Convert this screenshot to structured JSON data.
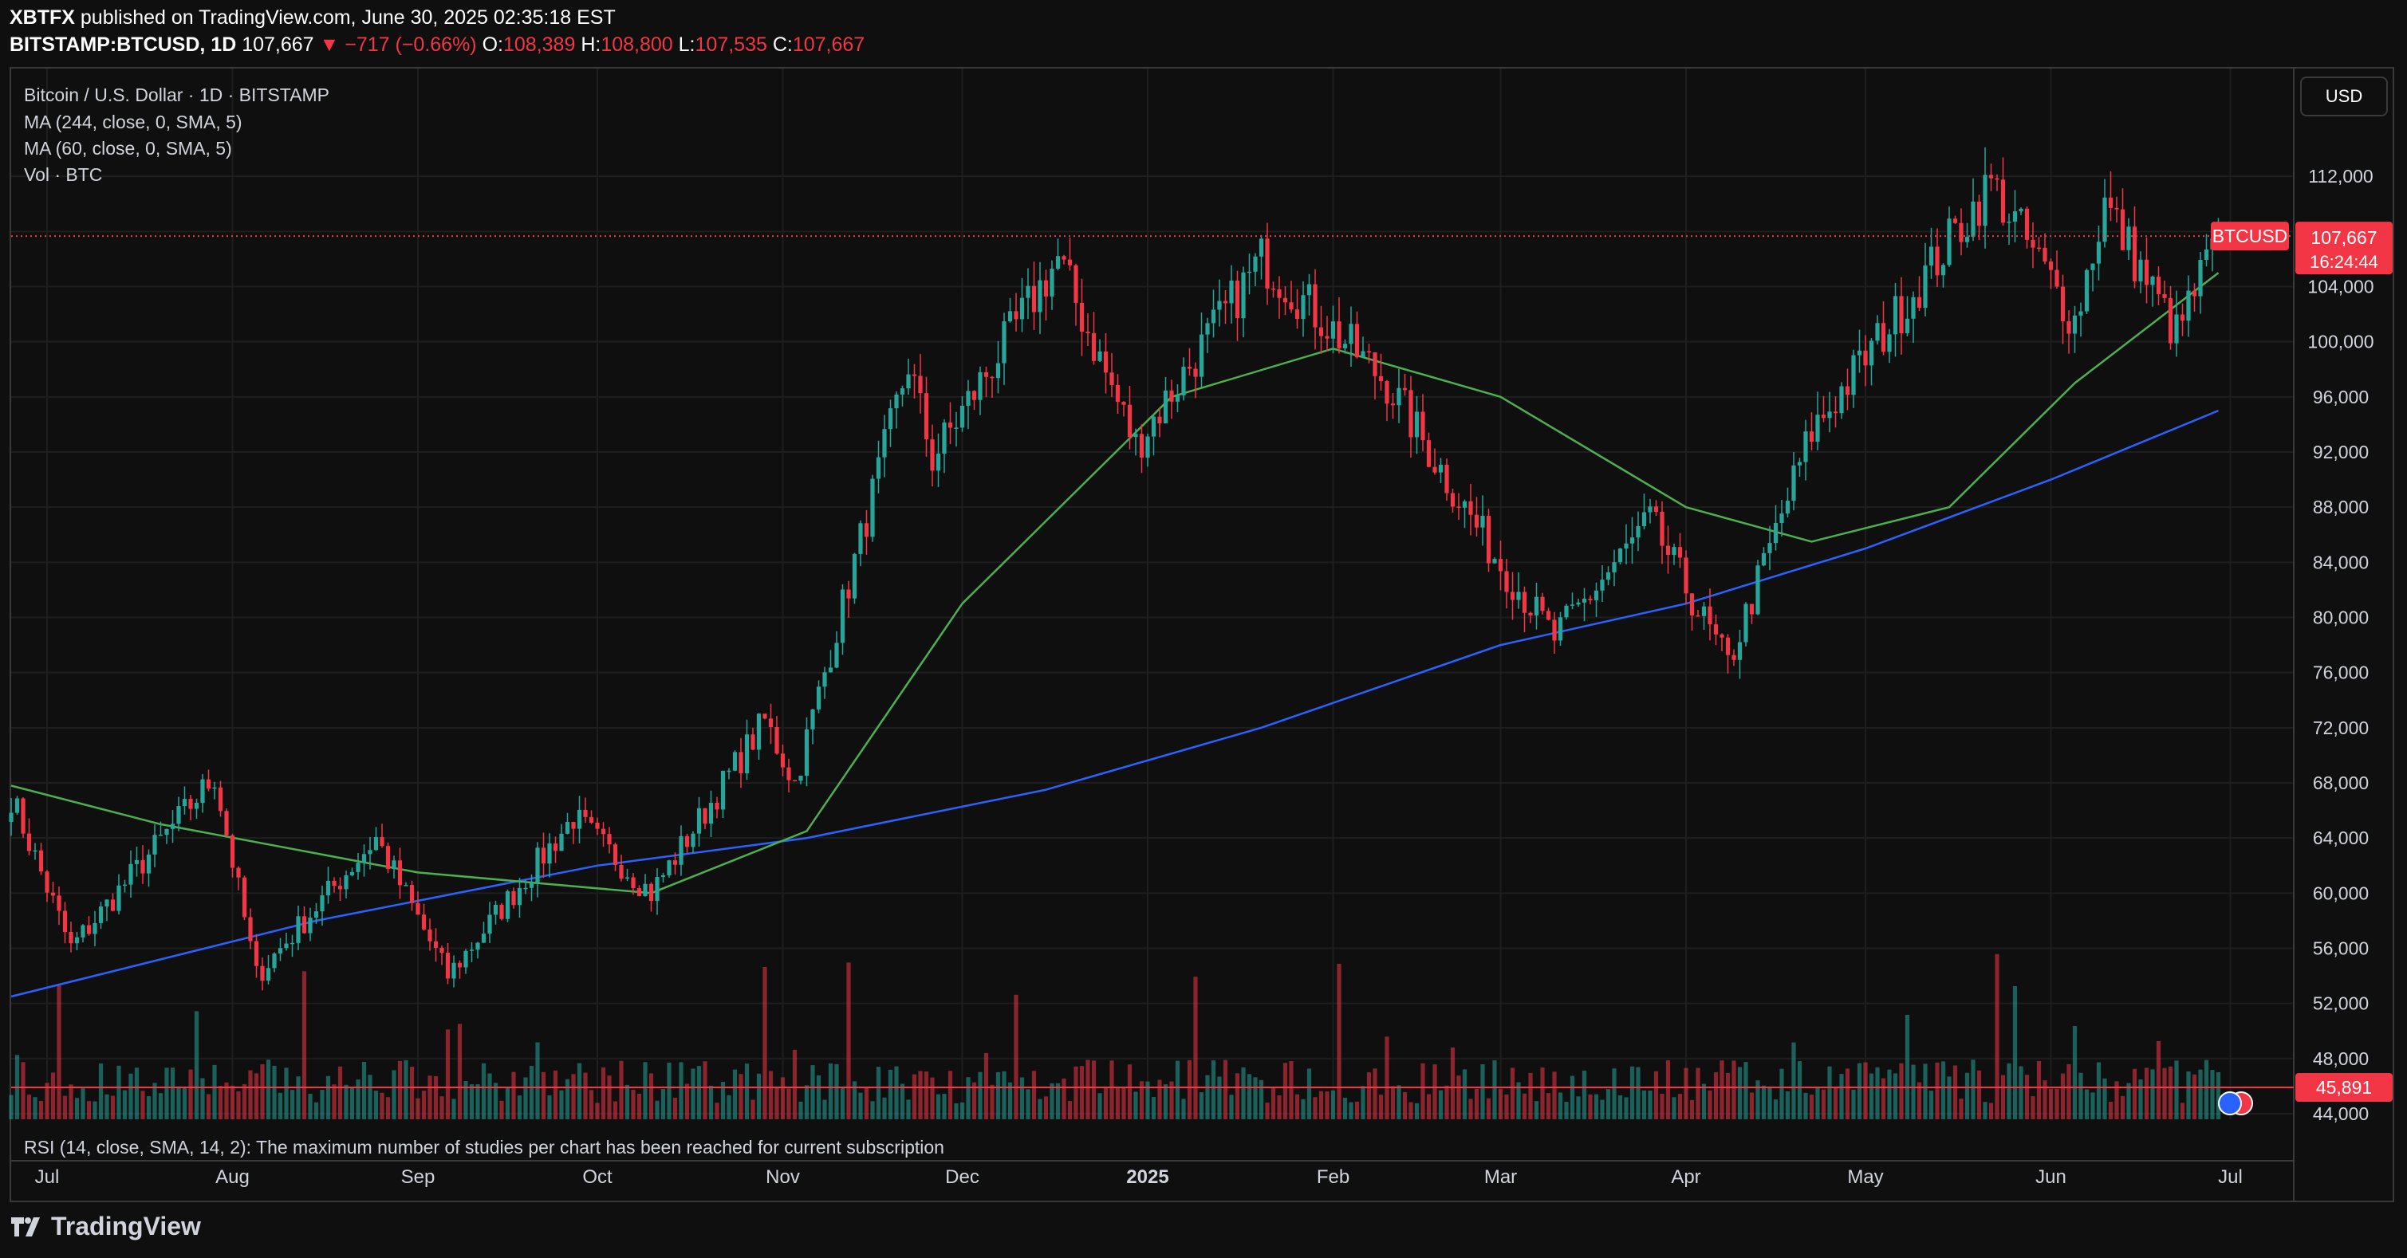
{
  "header": {
    "publisher": "XBTFX",
    "published_text": "published on TradingView.com, June 30, 2025 02:35:18 EST",
    "symbol_line": "BITSTAMP:BTCUSD, 1D",
    "last_price": "107,667",
    "change": "▼ −717 (−0.66%)",
    "open_label": "O:",
    "open": "108,389",
    "high_label": "H:",
    "high": "108,800",
    "low_label": "L:",
    "low": "107,535",
    "close_label": "C:",
    "close": "107,667"
  },
  "legend": {
    "title": "Bitcoin / U.S. Dollar · 1D · BITSTAMP",
    "ma1": "MA (244, close, 0, SMA, 5)",
    "ma2": "MA (60, close, 0, SMA, 5)",
    "vol": "Vol · BTC",
    "rsi_note": "RSI (14, close, SMA, 14, 2): The maximum number of studies per chart has been reached for current subscription"
  },
  "currency_button": "USD",
  "price_badges": {
    "symbol": "BTCUSD",
    "price": "107,667",
    "countdown": "16:24:44",
    "volume_value": "45,891"
  },
  "colors": {
    "up": "#26a69a",
    "down": "#f23645",
    "ma244": "#2962ff",
    "ma60": "#4caf50",
    "background": "#0f0f0f",
    "grid": "#1e1e1e"
  },
  "footer": {
    "brand": "TradingView"
  },
  "chart_data": {
    "type": "candlestick",
    "timeframe": "1D",
    "x_ticks": [
      "Jul",
      "Aug",
      "Sep",
      "Oct",
      "Nov",
      "Dec",
      "2025",
      "Feb",
      "Mar",
      "Apr",
      "May",
      "Jun",
      "Jul"
    ],
    "y_ticks": [
      "112,000",
      "108,000",
      "104,000",
      "100,000",
      "96,000",
      "92,000",
      "88,000",
      "84,000",
      "80,000",
      "76,000",
      "72,000",
      "68,000",
      "64,000",
      "60,000",
      "56,000",
      "52,000",
      "48,000",
      "44,000"
    ],
    "ylim": [
      44000,
      116000
    ],
    "current_price": 107667,
    "series": [
      {
        "name": "MA (244, close, 0, SMA, 5)"
      },
      {
        "name": "MA (60, close, 0, SMA, 5)"
      },
      {
        "name": "Vol · BTC"
      }
    ],
    "key_closes": [
      {
        "date": "2024-06-25",
        "close": 67000
      },
      {
        "date": "2024-07-05",
        "close": 56000
      },
      {
        "date": "2024-07-29",
        "close": 68500
      },
      {
        "date": "2024-08-05",
        "close": 54000
      },
      {
        "date": "2024-08-25",
        "close": 64000
      },
      {
        "date": "2024-09-06",
        "close": 54000
      },
      {
        "date": "2024-09-27",
        "close": 65500
      },
      {
        "date": "2024-10-10",
        "close": 60000
      },
      {
        "date": "2024-10-29",
        "close": 72500
      },
      {
        "date": "2024-11-03",
        "close": 68000
      },
      {
        "date": "2024-11-22",
        "close": 98500
      },
      {
        "date": "2024-11-26",
        "close": 91500
      },
      {
        "date": "2024-12-17",
        "close": 106000
      },
      {
        "date": "2024-12-30",
        "close": 92500
      },
      {
        "date": "2025-01-20",
        "close": 106000
      },
      {
        "date": "2025-02-10",
        "close": 97000
      },
      {
        "date": "2025-02-28",
        "close": 84500
      },
      {
        "date": "2025-03-10",
        "close": 78500
      },
      {
        "date": "2025-03-26",
        "close": 87000
      },
      {
        "date": "2025-04-08",
        "close": 76500
      },
      {
        "date": "2025-04-22",
        "close": 93500
      },
      {
        "date": "2025-05-08",
        "close": 103000
      },
      {
        "date": "2025-05-22",
        "close": 111500
      },
      {
        "date": "2025-06-05",
        "close": 101500
      },
      {
        "date": "2025-06-10",
        "close": 110000
      },
      {
        "date": "2025-06-22",
        "close": 100500
      },
      {
        "date": "2025-06-29",
        "close": 107667
      }
    ],
    "ma60_points": [
      {
        "date": "2024-06-25",
        "value": 67800
      },
      {
        "date": "2024-07-20",
        "value": 65000
      },
      {
        "date": "2024-09-01",
        "value": 61500
      },
      {
        "date": "2024-10-10",
        "value": 60000
      },
      {
        "date": "2024-11-05",
        "value": 64500
      },
      {
        "date": "2024-12-01",
        "value": 81000
      },
      {
        "date": "2025-01-05",
        "value": 96000
      },
      {
        "date": "2025-02-01",
        "value": 99500
      },
      {
        "date": "2025-03-01",
        "value": 96000
      },
      {
        "date": "2025-04-01",
        "value": 88000
      },
      {
        "date": "2025-04-22",
        "value": 85500
      },
      {
        "date": "2025-05-15",
        "value": 88000
      },
      {
        "date": "2025-06-05",
        "value": 97000
      },
      {
        "date": "2025-06-29",
        "value": 105000
      }
    ],
    "ma244_points": [
      {
        "date": "2024-06-25",
        "value": 52500
      },
      {
        "date": "2024-08-15",
        "value": 58000
      },
      {
        "date": "2024-10-01",
        "value": 62000
      },
      {
        "date": "2024-11-05",
        "value": 64000
      },
      {
        "date": "2024-12-15",
        "value": 67500
      },
      {
        "date": "2025-01-20",
        "value": 72000
      },
      {
        "date": "2025-03-01",
        "value": 78000
      },
      {
        "date": "2025-04-01",
        "value": 81000
      },
      {
        "date": "2025-05-01",
        "value": 85000
      },
      {
        "date": "2025-06-01",
        "value": 90000
      },
      {
        "date": "2025-06-29",
        "value": 95000
      }
    ]
  }
}
